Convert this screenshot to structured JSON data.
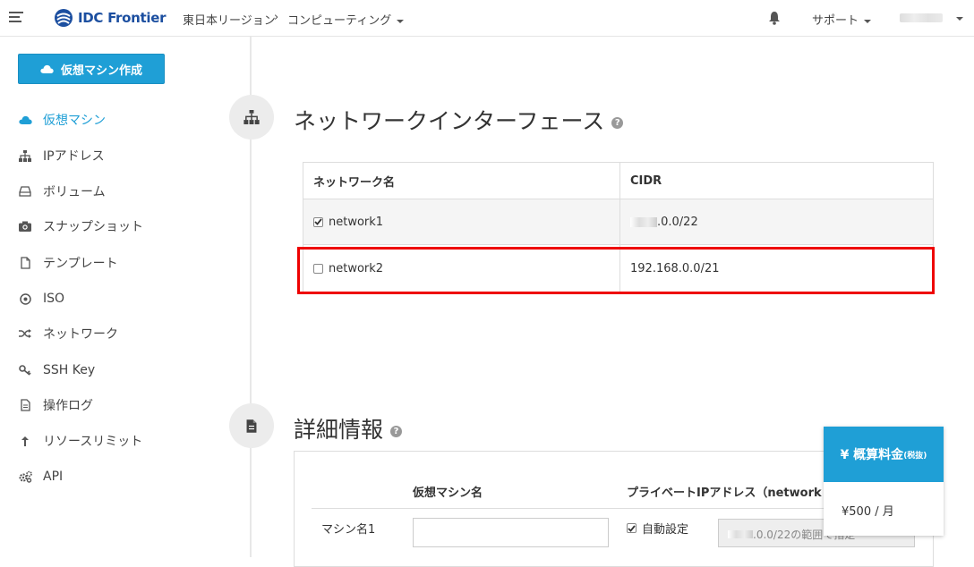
{
  "header": {
    "brand": "IDC Frontier",
    "region": "東日本リージョン",
    "region_sep": "›",
    "service": "コンピューティング",
    "support": "サポート"
  },
  "sidebar": {
    "create_button": "仮想マシン作成",
    "items": [
      {
        "label": "仮想マシン",
        "icon": "cloud-icon"
      },
      {
        "label": "IPアドレス",
        "icon": "sitemap-icon"
      },
      {
        "label": "ボリューム",
        "icon": "hdd-icon"
      },
      {
        "label": "スナップショット",
        "icon": "camera-icon"
      },
      {
        "label": "テンプレート",
        "icon": "file-icon"
      },
      {
        "label": "ISO",
        "icon": "disc-icon"
      },
      {
        "label": "ネットワーク",
        "icon": "shuffle-icon"
      },
      {
        "label": "SSH Key",
        "icon": "key-icon"
      },
      {
        "label": "操作ログ",
        "icon": "document-icon"
      },
      {
        "label": "リソースリミット",
        "icon": "arrow-up-icon"
      },
      {
        "label": "API",
        "icon": "gears-icon"
      }
    ]
  },
  "network_section": {
    "title": "ネットワークインターフェース",
    "columns": [
      "ネットワーク名",
      "CIDR"
    ],
    "rows": [
      {
        "name": "network1",
        "checked": true,
        "cidr": ".0.0/22"
      },
      {
        "name": "network2",
        "checked": false,
        "cidr": "192.168.0.0/21"
      }
    ]
  },
  "detail_section": {
    "title": "詳細情報",
    "col_vm_name": "仮想マシン名",
    "col_private_ip": "プライベートIPアドレス（network",
    "row_label": "マシン名1",
    "auto_label": "自動設定",
    "ip_placeholder": ".0.0/22の範囲で指定"
  },
  "price_panel": {
    "title": "¥ 概算料金",
    "title_note": "(税抜)",
    "amount": "¥500 / 月"
  },
  "colors": {
    "accent": "#1f9fd6",
    "highlight": "#ee0000"
  }
}
